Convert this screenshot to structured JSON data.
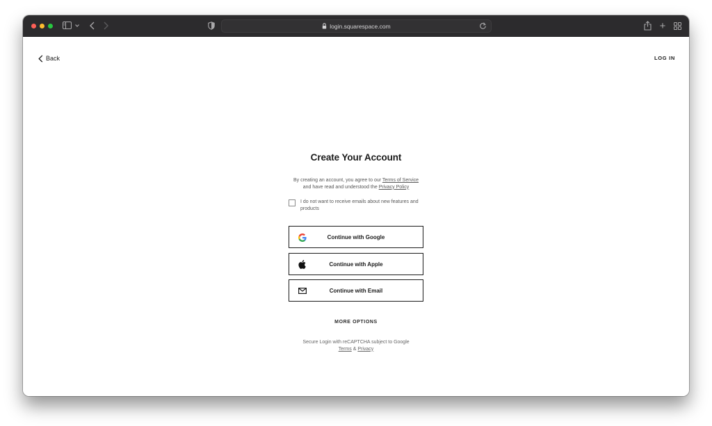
{
  "browser": {
    "url": "login.squarespace.com",
    "icons": {
      "traffic_lights": [
        "close",
        "minimize",
        "zoom"
      ],
      "sidebar": "sidebar-icon",
      "back": "chevron-left-icon",
      "forward": "chevron-right-icon",
      "privacy": "shield-icon",
      "lock": "lock-icon",
      "reload": "reload-icon",
      "share": "share-icon",
      "new_tab": "plus-icon",
      "tab_overview": "grid-icon"
    },
    "new_tab_glyph": "+"
  },
  "header": {
    "back_label": "Back",
    "login_label": "LOG IN"
  },
  "main": {
    "title": "Create Your Account",
    "agreement": {
      "prefix": "By creating an account, you agree to our ",
      "terms_link": "Terms of Service",
      "middle": " and have read and understood the ",
      "privacy_link": "Privacy Policy"
    },
    "email_optout": {
      "label": "I do not want to receive emails about new features and products",
      "checked": false
    },
    "buttons": [
      {
        "label": "Continue with Google",
        "icon": "google-icon"
      },
      {
        "label": "Continue with Apple",
        "icon": "apple-icon"
      },
      {
        "label": "Continue with Email",
        "icon": "mail-icon"
      }
    ],
    "more_options": "MORE OPTIONS",
    "recaptcha": {
      "text": "Secure Login with reCAPTCHA subject to Google",
      "terms_link": "Terms",
      "amp": " & ",
      "privacy_link": "Privacy"
    }
  },
  "colors": {
    "titlebar": "#2c2b2d",
    "text": "#1a1a1a",
    "muted_text": "#555555",
    "traffic_red": "#fe5f57",
    "traffic_yellow": "#febc2e",
    "traffic_green": "#28c840"
  }
}
